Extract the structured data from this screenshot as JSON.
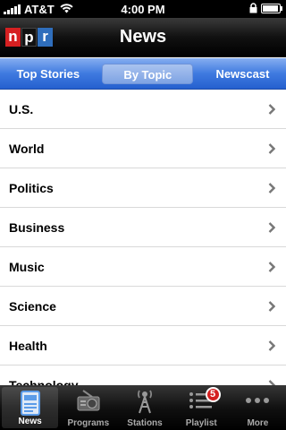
{
  "status_bar": {
    "carrier": "AT&T",
    "time": "4:00 PM",
    "battery_level": 0.95
  },
  "nav": {
    "logo_letters": [
      "n",
      "p",
      "r"
    ],
    "title": "News"
  },
  "segments": {
    "tabs": [
      {
        "label": "Top Stories",
        "active": false
      },
      {
        "label": "By Topic",
        "active": true
      },
      {
        "label": "Newscast",
        "active": false
      }
    ]
  },
  "topics": [
    {
      "label": "U.S."
    },
    {
      "label": "World"
    },
    {
      "label": "Politics"
    },
    {
      "label": "Business"
    },
    {
      "label": "Music"
    },
    {
      "label": "Science"
    },
    {
      "label": "Health"
    },
    {
      "label": "Technology"
    }
  ],
  "tab_bar": {
    "items": [
      {
        "label": "News",
        "icon": "news-icon",
        "active": true
      },
      {
        "label": "Programs",
        "icon": "radio-icon",
        "active": false
      },
      {
        "label": "Stations",
        "icon": "tower-icon",
        "active": false
      },
      {
        "label": "Playlist",
        "icon": "playlist-icon",
        "active": false,
        "badge": "5"
      },
      {
        "label": "More",
        "icon": "more-icon",
        "active": false
      }
    ]
  },
  "colors": {
    "npr_red": "#d62021",
    "npr_blue": "#2f6ebc",
    "segment_blue": "#3f7ae0",
    "badge_red": "#d42020"
  }
}
